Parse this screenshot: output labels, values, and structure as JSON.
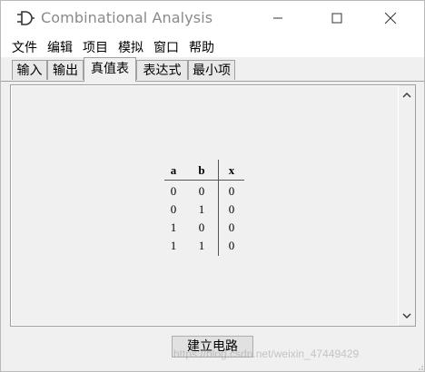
{
  "window": {
    "title": "Combinational Analysis",
    "controls": [
      "minimize-icon",
      "maximize-icon",
      "close-icon"
    ]
  },
  "menu": {
    "items": [
      "文件",
      "编辑",
      "项目",
      "模拟",
      "窗口",
      "帮助"
    ]
  },
  "tabs": {
    "items": [
      "输入",
      "输出",
      "真值表",
      "表达式",
      "最小项"
    ],
    "active": "真值表"
  },
  "truth_table": {
    "headers": [
      "a",
      "b",
      "x"
    ],
    "rows": [
      [
        "0",
        "0",
        "0"
      ],
      [
        "0",
        "1",
        "0"
      ],
      [
        "1",
        "0",
        "0"
      ],
      [
        "1",
        "1",
        "0"
      ]
    ]
  },
  "footer": {
    "build_button": "建立电路"
  },
  "watermark": "https://blog.csdn.net/weixin_47449429",
  "colors": {
    "window_bg": "#f0f0f0",
    "titlebar_bg": "#ffffff",
    "title_text": "#8a8a8a"
  }
}
